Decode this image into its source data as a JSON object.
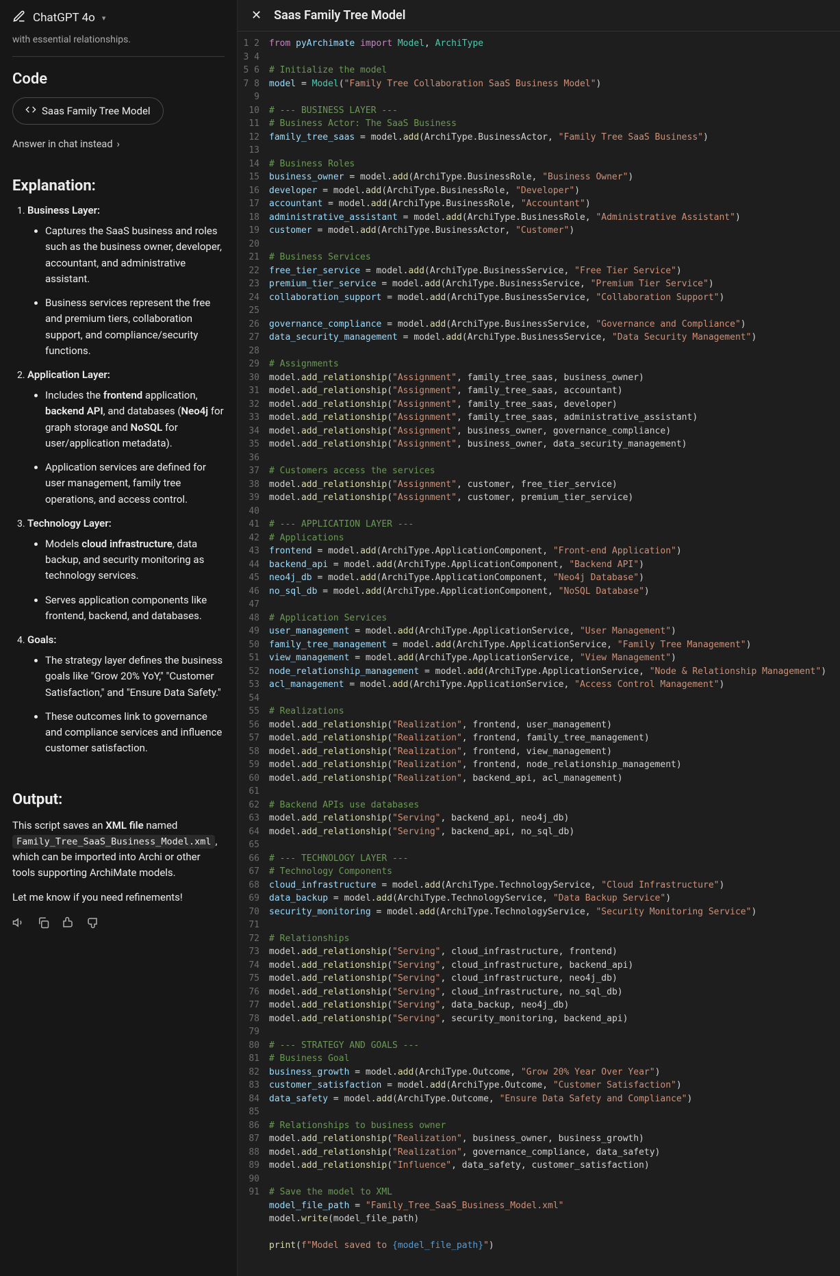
{
  "header": {
    "model_name": "ChatGPT 4o",
    "main_title": "Saas Family Tree Model"
  },
  "sidebar": {
    "truncated_line": "with essential relationships.",
    "code_heading": "Code",
    "chip_label": "Saas Family Tree Model",
    "answer_instead": "Answer in chat instead",
    "explanation_heading": "Explanation:",
    "sections": [
      {
        "title": "Business Layer:",
        "bullets_html": [
          "Captures the SaaS business and roles such as the business owner, developer, accountant, and administrative assistant.",
          "Business services represent the free and premium tiers, collaboration support, and compliance/security functions."
        ]
      },
      {
        "title": "Application Layer:",
        "bullets_html": [
          "Includes the <span class=\"bold\">frontend</span> application, <span class=\"bold\">backend API</span>, and databases (<span class=\"bold\">Neo4j</span> for graph storage and <span class=\"bold\">NoSQL</span> for user/application metadata).",
          "Application services are defined for user management, family tree operations, and access control."
        ]
      },
      {
        "title": "Technology Layer:",
        "bullets_html": [
          "Models <span class=\"bold\">cloud infrastructure</span>, data backup, and security monitoring as technology services.",
          "Serves application components like frontend, backend, and databases."
        ]
      },
      {
        "title": "Goals:",
        "bullets_html": [
          "The strategy layer defines the business goals like \"Grow 20% YoY,\" \"Customer Satisfaction,\" and \"Ensure Data Safety.\"",
          "These outcomes link to governance and compliance services and influence customer satisfaction."
        ]
      }
    ],
    "output_heading": "Output:",
    "output_line1_pre": "This script saves an ",
    "output_line1_bold": "XML file",
    "output_line1_post": " named ",
    "output_filename": "Family_Tree_SaaS_Business_Model.xml",
    "output_line2": ", which can be imported into Archi or other tools supporting ArchiMate models.",
    "output_line3": "Let me know if you need refinements!"
  },
  "code": {
    "lines": [
      {
        "n": 1,
        "h": "<span class=\"c-kw\">from</span> <span class=\"c-var\">pyArchimate</span> <span class=\"c-kw\">import</span> <span class=\"c-cls\">Model</span>, <span class=\"c-cls\">ArchiType</span>"
      },
      {
        "n": 2,
        "h": ""
      },
      {
        "n": 3,
        "h": "<span class=\"c-cmt\"># Initialize the model</span>"
      },
      {
        "n": 4,
        "h": "<span class=\"c-var\">model</span> = <span class=\"c-cls\">Model</span>(<span class=\"c-str\">\"Family Tree Collaboration SaaS Business Model\"</span>)"
      },
      {
        "n": 5,
        "h": ""
      },
      {
        "n": 6,
        "h": "<span class=\"c-cmt\"># --- BUSINESS LAYER ---</span>"
      },
      {
        "n": 7,
        "h": "<span class=\"c-cmt\"># Business Actor: The SaaS Business</span>"
      },
      {
        "n": 8,
        "h": "<span class=\"c-var\">family_tree_saas</span> = model.<span class=\"c-fn\">add</span>(ArchiType.BusinessActor, <span class=\"c-str\">\"Family Tree SaaS Business\"</span>)"
      },
      {
        "n": 9,
        "h": ""
      },
      {
        "n": 10,
        "h": "<span class=\"c-cmt\"># Business Roles</span>"
      },
      {
        "n": 11,
        "h": "<span class=\"c-var\">business_owner</span> = model.<span class=\"c-fn\">add</span>(ArchiType.BusinessRole, <span class=\"c-str\">\"Business Owner\"</span>)"
      },
      {
        "n": 12,
        "h": "<span class=\"c-var\">developer</span> = model.<span class=\"c-fn\">add</span>(ArchiType.BusinessRole, <span class=\"c-str\">\"Developer\"</span>)"
      },
      {
        "n": 13,
        "h": "<span class=\"c-var\">accountant</span> = model.<span class=\"c-fn\">add</span>(ArchiType.BusinessRole, <span class=\"c-str\">\"Accountant\"</span>)"
      },
      {
        "n": 14,
        "h": "<span class=\"c-var\">administrative_assistant</span> = model.<span class=\"c-fn\">add</span>(ArchiType.BusinessRole, <span class=\"c-str\">\"Administrative Assistant\"</span>)"
      },
      {
        "n": 15,
        "h": "<span class=\"c-var\">customer</span> = model.<span class=\"c-fn\">add</span>(ArchiType.BusinessActor, <span class=\"c-str\">\"Customer\"</span>)"
      },
      {
        "n": 16,
        "h": ""
      },
      {
        "n": 17,
        "h": "<span class=\"c-cmt\"># Business Services</span>"
      },
      {
        "n": 18,
        "h": "<span class=\"c-var\">free_tier_service</span> = model.<span class=\"c-fn\">add</span>(ArchiType.BusinessService, <span class=\"c-str\">\"Free Tier Service\"</span>)"
      },
      {
        "n": 19,
        "h": "<span class=\"c-var\">premium_tier_service</span> = model.<span class=\"c-fn\">add</span>(ArchiType.BusinessService, <span class=\"c-str\">\"Premium Tier Service\"</span>)"
      },
      {
        "n": 20,
        "h": "<span class=\"c-var\">collaboration_support</span> = model.<span class=\"c-fn\">add</span>(ArchiType.BusinessService, <span class=\"c-str\">\"Collaboration Support\"</span>)"
      },
      {
        "n": 21,
        "h": ""
      },
      {
        "n": 22,
        "h": "<span class=\"c-var\">governance_compliance</span> = model.<span class=\"c-fn\">add</span>(ArchiType.BusinessService, <span class=\"c-str\">\"Governance and Compliance\"</span>)"
      },
      {
        "n": 23,
        "h": "<span class=\"c-var\">data_security_management</span> = model.<span class=\"c-fn\">add</span>(ArchiType.BusinessService, <span class=\"c-str\">\"Data Security Management\"</span>)"
      },
      {
        "n": 24,
        "h": ""
      },
      {
        "n": 25,
        "h": "<span class=\"c-cmt\"># Assignments</span>"
      },
      {
        "n": 26,
        "h": "model.<span class=\"c-fn\">add_relationship</span>(<span class=\"c-str\">\"Assignment\"</span>, family_tree_saas, business_owner)"
      },
      {
        "n": 27,
        "h": "model.<span class=\"c-fn\">add_relationship</span>(<span class=\"c-str\">\"Assignment\"</span>, family_tree_saas, accountant)"
      },
      {
        "n": 28,
        "h": "model.<span class=\"c-fn\">add_relationship</span>(<span class=\"c-str\">\"Assignment\"</span>, family_tree_saas, developer)"
      },
      {
        "n": 29,
        "h": "model.<span class=\"c-fn\">add_relationship</span>(<span class=\"c-str\">\"Assignment\"</span>, family_tree_saas, administrative_assistant)"
      },
      {
        "n": 30,
        "h": "model.<span class=\"c-fn\">add_relationship</span>(<span class=\"c-str\">\"Assignment\"</span>, business_owner, governance_compliance)"
      },
      {
        "n": 31,
        "h": "model.<span class=\"c-fn\">add_relationship</span>(<span class=\"c-str\">\"Assignment\"</span>, business_owner, data_security_management)"
      },
      {
        "n": 32,
        "h": ""
      },
      {
        "n": 33,
        "h": "<span class=\"c-cmt\"># Customers access the services</span>"
      },
      {
        "n": 34,
        "h": "model.<span class=\"c-fn\">add_relationship</span>(<span class=\"c-str\">\"Assignment\"</span>, customer, free_tier_service)"
      },
      {
        "n": 35,
        "h": "model.<span class=\"c-fn\">add_relationship</span>(<span class=\"c-str\">\"Assignment\"</span>, customer, premium_tier_service)"
      },
      {
        "n": 36,
        "h": ""
      },
      {
        "n": 37,
        "h": "<span class=\"c-cmt\"># --- APPLICATION LAYER ---</span>"
      },
      {
        "n": 38,
        "h": "<span class=\"c-cmt\"># Applications</span>"
      },
      {
        "n": 39,
        "h": "<span class=\"c-var\">frontend</span> = model.<span class=\"c-fn\">add</span>(ArchiType.ApplicationComponent, <span class=\"c-str\">\"Front-end Application\"</span>)"
      },
      {
        "n": 40,
        "h": "<span class=\"c-var\">backend_api</span> = model.<span class=\"c-fn\">add</span>(ArchiType.ApplicationComponent, <span class=\"c-str\">\"Backend API\"</span>)"
      },
      {
        "n": 41,
        "h": "<span class=\"c-var\">neo4j_db</span> = model.<span class=\"c-fn\">add</span>(ArchiType.ApplicationComponent, <span class=\"c-str\">\"Neo4j Database\"</span>)"
      },
      {
        "n": 42,
        "h": "<span class=\"c-var\">no_sql_db</span> = model.<span class=\"c-fn\">add</span>(ArchiType.ApplicationComponent, <span class=\"c-str\">\"NoSQL Database\"</span>)"
      },
      {
        "n": 43,
        "h": ""
      },
      {
        "n": 44,
        "h": "<span class=\"c-cmt\"># Application Services</span>"
      },
      {
        "n": 45,
        "h": "<span class=\"c-var\">user_management</span> = model.<span class=\"c-fn\">add</span>(ArchiType.ApplicationService, <span class=\"c-str\">\"User Management\"</span>)"
      },
      {
        "n": 46,
        "h": "<span class=\"c-var\">family_tree_management</span> = model.<span class=\"c-fn\">add</span>(ArchiType.ApplicationService, <span class=\"c-str\">\"Family Tree Management\"</span>)"
      },
      {
        "n": 47,
        "h": "<span class=\"c-var\">view_management</span> = model.<span class=\"c-fn\">add</span>(ArchiType.ApplicationService, <span class=\"c-str\">\"View Management\"</span>)"
      },
      {
        "n": 48,
        "h": "<span class=\"c-var\">node_relationship_management</span> = model.<span class=\"c-fn\">add</span>(ArchiType.ApplicationService, <span class=\"c-str\">\"Node & Relationship Management\"</span>)"
      },
      {
        "n": 49,
        "h": "<span class=\"c-var\">acl_management</span> = model.<span class=\"c-fn\">add</span>(ArchiType.ApplicationService, <span class=\"c-str\">\"Access Control Management\"</span>)"
      },
      {
        "n": 50,
        "h": ""
      },
      {
        "n": 51,
        "h": "<span class=\"c-cmt\"># Realizations</span>"
      },
      {
        "n": 52,
        "h": "model.<span class=\"c-fn\">add_relationship</span>(<span class=\"c-str\">\"Realization\"</span>, frontend, user_management)"
      },
      {
        "n": 53,
        "h": "model.<span class=\"c-fn\">add_relationship</span>(<span class=\"c-str\">\"Realization\"</span>, frontend, family_tree_management)"
      },
      {
        "n": 54,
        "h": "model.<span class=\"c-fn\">add_relationship</span>(<span class=\"c-str\">\"Realization\"</span>, frontend, view_management)"
      },
      {
        "n": 55,
        "h": "model.<span class=\"c-fn\">add_relationship</span>(<span class=\"c-str\">\"Realization\"</span>, frontend, node_relationship_management)"
      },
      {
        "n": 56,
        "h": "model.<span class=\"c-fn\">add_relationship</span>(<span class=\"c-str\">\"Realization\"</span>, backend_api, acl_management)"
      },
      {
        "n": 57,
        "h": ""
      },
      {
        "n": 58,
        "h": "<span class=\"c-cmt\"># Backend APIs use databases</span>"
      },
      {
        "n": 59,
        "h": "model.<span class=\"c-fn\">add_relationship</span>(<span class=\"c-str\">\"Serving\"</span>, backend_api, neo4j_db)"
      },
      {
        "n": 60,
        "h": "model.<span class=\"c-fn\">add_relationship</span>(<span class=\"c-str\">\"Serving\"</span>, backend_api, no_sql_db)"
      },
      {
        "n": 61,
        "h": ""
      },
      {
        "n": 62,
        "h": "<span class=\"c-cmt\"># --- TECHNOLOGY LAYER ---</span>"
      },
      {
        "n": 63,
        "h": "<span class=\"c-cmt\"># Technology Components</span>"
      },
      {
        "n": 64,
        "h": "<span class=\"c-var\">cloud_infrastructure</span> = model.<span class=\"c-fn\">add</span>(ArchiType.TechnologyService, <span class=\"c-str\">\"Cloud Infrastructure\"</span>)"
      },
      {
        "n": 65,
        "h": "<span class=\"c-var\">data_backup</span> = model.<span class=\"c-fn\">add</span>(ArchiType.TechnologyService, <span class=\"c-str\">\"Data Backup Service\"</span>)"
      },
      {
        "n": 66,
        "h": "<span class=\"c-var\">security_monitoring</span> = model.<span class=\"c-fn\">add</span>(ArchiType.TechnologyService, <span class=\"c-str\">\"Security Monitoring Service\"</span>)"
      },
      {
        "n": 67,
        "h": ""
      },
      {
        "n": 68,
        "h": "<span class=\"c-cmt\"># Relationships</span>"
      },
      {
        "n": 69,
        "h": "model.<span class=\"c-fn\">add_relationship</span>(<span class=\"c-str\">\"Serving\"</span>, cloud_infrastructure, frontend)"
      },
      {
        "n": 70,
        "h": "model.<span class=\"c-fn\">add_relationship</span>(<span class=\"c-str\">\"Serving\"</span>, cloud_infrastructure, backend_api)"
      },
      {
        "n": 71,
        "h": "model.<span class=\"c-fn\">add_relationship</span>(<span class=\"c-str\">\"Serving\"</span>, cloud_infrastructure, neo4j_db)"
      },
      {
        "n": 72,
        "h": "model.<span class=\"c-fn\">add_relationship</span>(<span class=\"c-str\">\"Serving\"</span>, cloud_infrastructure, no_sql_db)"
      },
      {
        "n": 73,
        "h": "model.<span class=\"c-fn\">add_relationship</span>(<span class=\"c-str\">\"Serving\"</span>, data_backup, neo4j_db)"
      },
      {
        "n": 74,
        "h": "model.<span class=\"c-fn\">add_relationship</span>(<span class=\"c-str\">\"Serving\"</span>, security_monitoring, backend_api)"
      },
      {
        "n": 75,
        "h": ""
      },
      {
        "n": 76,
        "h": "<span class=\"c-cmt\"># --- STRATEGY AND GOALS ---</span>"
      },
      {
        "n": 77,
        "h": "<span class=\"c-cmt\"># Business Goal</span>"
      },
      {
        "n": 78,
        "h": "<span class=\"c-var\">business_growth</span> = model.<span class=\"c-fn\">add</span>(ArchiType.Outcome, <span class=\"c-str\">\"Grow 20% Year Over Year\"</span>)"
      },
      {
        "n": 79,
        "h": "<span class=\"c-var\">customer_satisfaction</span> = model.<span class=\"c-fn\">add</span>(ArchiType.Outcome, <span class=\"c-str\">\"Customer Satisfaction\"</span>)"
      },
      {
        "n": 80,
        "h": "<span class=\"c-var\">data_safety</span> = model.<span class=\"c-fn\">add</span>(ArchiType.Outcome, <span class=\"c-str\">\"Ensure Data Safety and Compliance\"</span>)"
      },
      {
        "n": 81,
        "h": ""
      },
      {
        "n": 82,
        "h": "<span class=\"c-cmt\"># Relationships to business owner</span>"
      },
      {
        "n": 83,
        "h": "model.<span class=\"c-fn\">add_relationship</span>(<span class=\"c-str\">\"Realization\"</span>, business_owner, business_growth)"
      },
      {
        "n": 84,
        "h": "model.<span class=\"c-fn\">add_relationship</span>(<span class=\"c-str\">\"Realization\"</span>, governance_compliance, data_safety)"
      },
      {
        "n": 85,
        "h": "model.<span class=\"c-fn\">add_relationship</span>(<span class=\"c-str\">\"Influence\"</span>, data_safety, customer_satisfaction)"
      },
      {
        "n": 86,
        "h": ""
      },
      {
        "n": 87,
        "h": "<span class=\"c-cmt\"># Save the model to XML</span>"
      },
      {
        "n": 88,
        "h": "<span class=\"c-var\">model_file_path</span> = <span class=\"c-str\">\"Family_Tree_SaaS_Business_Model.xml\"</span>"
      },
      {
        "n": 89,
        "h": "model.<span class=\"c-fn\">write</span>(model_file_path)"
      },
      {
        "n": 90,
        "h": ""
      },
      {
        "n": 91,
        "h": "<span class=\"c-fn\">print</span>(<span class=\"c-str\">f\"Model saved to <span class=\"c-fmt\">{model_file_path}</span>\"</span>)"
      }
    ]
  }
}
